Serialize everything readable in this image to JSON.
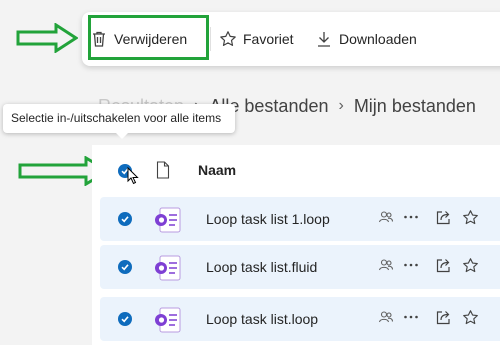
{
  "toolbar": {
    "delete_label": "Verwijderen",
    "favorite_label": "Favoriet",
    "download_label": "Downloaden"
  },
  "breadcrumb": {
    "hidden_label": "Resultaten",
    "items": [
      "Alle bestanden",
      "Mijn bestanden"
    ]
  },
  "tooltip": {
    "text": "Selectie in-/uitschakelen voor alle items"
  },
  "list": {
    "column_name": "Naam",
    "rows": [
      {
        "name": "Loop task list 1.loop",
        "selected": true
      },
      {
        "name": "Loop task list.fluid",
        "selected": true
      },
      {
        "name": "Loop task list.loop",
        "selected": true
      }
    ]
  },
  "colors": {
    "accent": "#0f6cbd",
    "annotation_green": "#22a33a",
    "row_selected_bg": "#ebf3fc",
    "loop_purple": "#7e3fd4"
  },
  "icons": [
    "trash-icon",
    "star-icon",
    "download-icon",
    "file-icon",
    "loop-icon",
    "people-icon",
    "more-icon",
    "share-icon",
    "favorite-star-icon",
    "check-icon",
    "cursor-icon",
    "annotation-arrow"
  ]
}
